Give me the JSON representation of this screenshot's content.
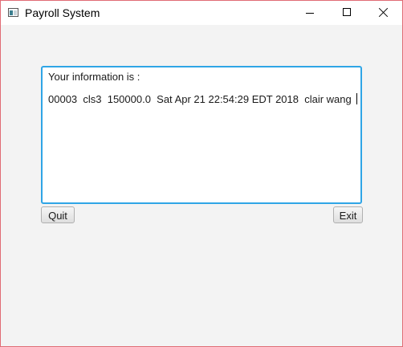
{
  "window": {
    "title": "Payroll System",
    "icon": "app-window-icon"
  },
  "textarea": {
    "header": "Your information is :",
    "record": "00003  cls3  150000.0  Sat Apr 21 22:54:29 EDT 2018  clair wang"
  },
  "buttons": {
    "quit": "Quit",
    "exit": "Exit"
  },
  "colors": {
    "focus_border": "#2fa5e6",
    "window_border": "#e06c75",
    "background": "#f3f3f3"
  }
}
